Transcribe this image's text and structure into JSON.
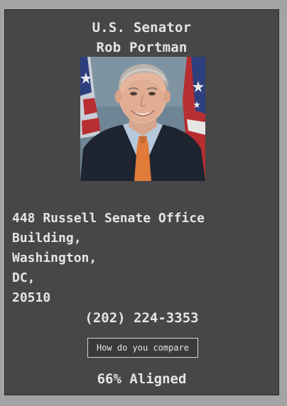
{
  "header": {
    "title_line1": "U.S. Senator",
    "title_line2": "Rob Portman"
  },
  "portrait": {
    "icon": "senator-portrait-photo",
    "colors": {
      "background": "#6f8292",
      "flag_red": "#b72e31",
      "flag_blue": "#2d3f7d",
      "suit": "#1e2430",
      "tie": "#e07b3a"
    }
  },
  "address": {
    "lines": [
      "448 Russell Senate Office",
      "Building,",
      "Washington,",
      "DC,",
      "20510"
    ]
  },
  "contact": {
    "phone": "(202) 224-3353"
  },
  "compare_button": {
    "label": "How do you compare"
  },
  "alignment": {
    "text": "66% Aligned",
    "percent": 66
  },
  "colors": {
    "page_bg": "#a3a3a3",
    "card_bg": "#474747",
    "text": "#e5e5e5"
  }
}
